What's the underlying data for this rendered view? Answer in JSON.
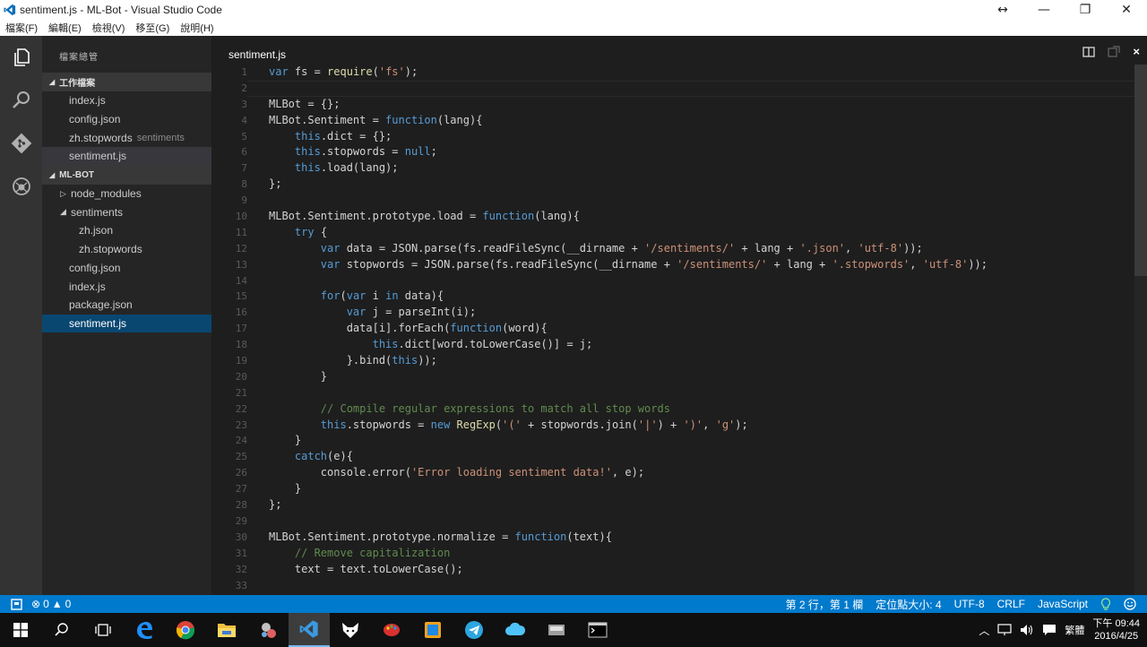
{
  "window": {
    "title": "sentiment.js - ML-Bot - Visual Studio Code",
    "controls": [
      "↔",
      "—",
      "❐",
      "✕"
    ]
  },
  "menu": [
    "檔案(F)",
    "編輯(E)",
    "檢視(V)",
    "移至(G)",
    "說明(H)"
  ],
  "activity": [
    "explorer-icon",
    "search-icon",
    "git-icon",
    "debug-icon"
  ],
  "sidebar": {
    "title": "檔案總管",
    "working_section": "工作檔案",
    "working_files": [
      {
        "label": "index.js",
        "sub": ""
      },
      {
        "label": "config.json",
        "sub": ""
      },
      {
        "label": "zh.stopwords",
        "sub": "sentiments"
      },
      {
        "label": "sentiment.js",
        "sub": ""
      }
    ],
    "project_section": "ML-BOT",
    "tree": [
      {
        "label": "node_modules",
        "arrow": "▷"
      },
      {
        "label": "sentiments",
        "arrow": "◢"
      },
      {
        "label": "zh.json",
        "arrow": ""
      },
      {
        "label": "zh.stopwords",
        "arrow": ""
      },
      {
        "label": "config.json",
        "arrow": ""
      },
      {
        "label": "index.js",
        "arrow": ""
      },
      {
        "label": "package.json",
        "arrow": ""
      },
      {
        "label": "sentiment.js",
        "arrow": ""
      }
    ]
  },
  "editor": {
    "tab": "sentiment.js",
    "lines": [
      [
        [
          "k",
          "var"
        ],
        [
          "p",
          " fs = "
        ],
        [
          "f",
          "require"
        ],
        [
          "p",
          "("
        ],
        [
          "s",
          "'fs'"
        ],
        [
          "p",
          ");"
        ]
      ],
      [],
      [
        [
          "p",
          "MLBot = {};"
        ]
      ],
      [
        [
          "p",
          "MLBot.Sentiment = "
        ],
        [
          "k",
          "function"
        ],
        [
          "p",
          "(lang){"
        ]
      ],
      [
        [
          "p",
          "    "
        ],
        [
          "k",
          "this"
        ],
        [
          "p",
          ".dict = {};"
        ]
      ],
      [
        [
          "p",
          "    "
        ],
        [
          "k",
          "this"
        ],
        [
          "p",
          ".stopwords = "
        ],
        [
          "k",
          "null"
        ],
        [
          "p",
          ";"
        ]
      ],
      [
        [
          "p",
          "    "
        ],
        [
          "k",
          "this"
        ],
        [
          "p",
          ".load(lang);"
        ]
      ],
      [
        [
          "p",
          "};"
        ]
      ],
      [],
      [
        [
          "p",
          "MLBot.Sentiment.prototype.load = "
        ],
        [
          "k",
          "function"
        ],
        [
          "p",
          "(lang){"
        ]
      ],
      [
        [
          "p",
          "    "
        ],
        [
          "k",
          "try"
        ],
        [
          "p",
          " {"
        ]
      ],
      [
        [
          "p",
          "        "
        ],
        [
          "k",
          "var"
        ],
        [
          "p",
          " data = JSON.parse(fs.readFileSync(__dirname + "
        ],
        [
          "s",
          "'/sentiments/'"
        ],
        [
          "p",
          " + lang + "
        ],
        [
          "s",
          "'.json'"
        ],
        [
          "p",
          ", "
        ],
        [
          "s",
          "'utf-8'"
        ],
        [
          "p",
          "));"
        ]
      ],
      [
        [
          "p",
          "        "
        ],
        [
          "k",
          "var"
        ],
        [
          "p",
          " stopwords = JSON.parse(fs.readFileSync(__dirname + "
        ],
        [
          "s",
          "'/sentiments/'"
        ],
        [
          "p",
          " + lang + "
        ],
        [
          "s",
          "'.stopwords'"
        ],
        [
          "p",
          ", "
        ],
        [
          "s",
          "'utf-8'"
        ],
        [
          "p",
          "));"
        ]
      ],
      [],
      [
        [
          "p",
          "        "
        ],
        [
          "k",
          "for"
        ],
        [
          "p",
          "("
        ],
        [
          "k",
          "var"
        ],
        [
          "p",
          " i "
        ],
        [
          "k",
          "in"
        ],
        [
          "p",
          " data){"
        ]
      ],
      [
        [
          "p",
          "            "
        ],
        [
          "k",
          "var"
        ],
        [
          "p",
          " j = parseInt(i);"
        ]
      ],
      [
        [
          "p",
          "            data[i].forEach("
        ],
        [
          "k",
          "function"
        ],
        [
          "p",
          "(word){"
        ]
      ],
      [
        [
          "p",
          "                "
        ],
        [
          "k",
          "this"
        ],
        [
          "p",
          ".dict[word.toLowerCase()] = j;"
        ]
      ],
      [
        [
          "p",
          "            }.bind("
        ],
        [
          "k",
          "this"
        ],
        [
          "p",
          "));"
        ]
      ],
      [
        [
          "p",
          "        }"
        ]
      ],
      [],
      [
        [
          "p",
          "        "
        ],
        [
          "c",
          "// Compile regular expressions to match all stop words"
        ]
      ],
      [
        [
          "p",
          "        "
        ],
        [
          "k",
          "this"
        ],
        [
          "p",
          ".stopwords = "
        ],
        [
          "k",
          "new"
        ],
        [
          "p",
          " "
        ],
        [
          "f",
          "RegExp"
        ],
        [
          "p",
          "("
        ],
        [
          "s",
          "'('"
        ],
        [
          "p",
          " + stopwords.join("
        ],
        [
          "s",
          "'|'"
        ],
        [
          "p",
          ") + "
        ],
        [
          "s",
          "')'"
        ],
        [
          "p",
          ", "
        ],
        [
          "s",
          "'g'"
        ],
        [
          "p",
          ");"
        ]
      ],
      [
        [
          "p",
          "    }"
        ]
      ],
      [
        [
          "p",
          "    "
        ],
        [
          "k",
          "catch"
        ],
        [
          "p",
          "(e){"
        ]
      ],
      [
        [
          "p",
          "        console.error("
        ],
        [
          "s",
          "'Error loading sentiment data!'"
        ],
        [
          "p",
          ", e);"
        ]
      ],
      [
        [
          "p",
          "    }"
        ]
      ],
      [
        [
          "p",
          "};"
        ]
      ],
      [],
      [
        [
          "p",
          "MLBot.Sentiment.prototype.normalize = "
        ],
        [
          "k",
          "function"
        ],
        [
          "p",
          "(text){"
        ]
      ],
      [
        [
          "p",
          "    "
        ],
        [
          "c",
          "// Remove capitalization"
        ]
      ],
      [
        [
          "p",
          "    text = text.toLowerCase();"
        ]
      ],
      []
    ]
  },
  "status": {
    "errors": "0",
    "warnings": "0",
    "position": "第 2 行，第 1 欄",
    "indent": "定位點大小: 4",
    "encoding": "UTF-8",
    "eol": "CRLF",
    "language": "JavaScript"
  },
  "tray": {
    "ime": "繁體",
    "time": "下午 09:44",
    "date": "2016/4/25"
  },
  "colors": {
    "accent": "#007acc",
    "keyword": "#569cd6",
    "string": "#ce9178",
    "comment": "#608b4e"
  }
}
